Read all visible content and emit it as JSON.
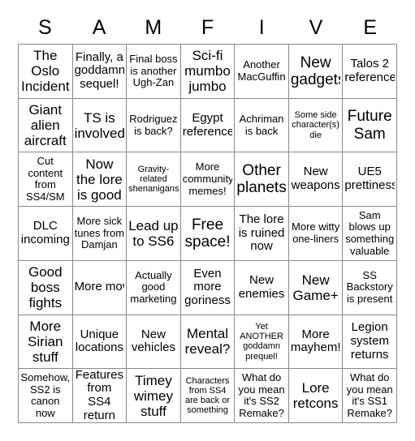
{
  "card": {
    "title_letters": [
      "S",
      "A",
      "M",
      "F",
      "I",
      "V",
      "E"
    ],
    "rows": 7,
    "columns": 7,
    "colors": {
      "background": "#ffffff",
      "text": "#000000",
      "grid_line": "#888888"
    }
  },
  "cells": [
    [
      {
        "text": "The Oslo Incident",
        "size": "lg"
      },
      {
        "text": "Finally, a goddamn sequel!",
        "size": "md"
      },
      {
        "text": "Final boss is another Ugh-Zan",
        "size": "sm"
      },
      {
        "text": "Sci-fi mumbo jumbo",
        "size": "lg"
      },
      {
        "text": "Another MacGuffin",
        "size": "sm"
      },
      {
        "text": "New gadgets",
        "size": "xl"
      },
      {
        "text": "Talos 2 reference",
        "size": "md"
      }
    ],
    [
      {
        "text": "Giant alien aircraft",
        "size": "lg"
      },
      {
        "text": "TS is involved",
        "size": "lg"
      },
      {
        "text": "Rodriguez is back?",
        "size": "sm"
      },
      {
        "text": "Egypt reference",
        "size": "md"
      },
      {
        "text": "Achriman is back",
        "size": "sm"
      },
      {
        "text": "Some side character(s) die",
        "size": "xs"
      },
      {
        "text": "Future Sam",
        "size": "xl"
      }
    ],
    [
      {
        "text": "Cut content from SS4/SM",
        "size": "sm"
      },
      {
        "text": "Now the lore is good",
        "size": "lg"
      },
      {
        "text": "Gravity-related shenanigans",
        "size": "xs"
      },
      {
        "text": "More community memes!",
        "size": "sm"
      },
      {
        "text": "Other planets",
        "size": "xl"
      },
      {
        "text": "New weapons",
        "size": "md"
      },
      {
        "text": "UE5 prettiness",
        "size": "md"
      }
    ],
    [
      {
        "text": "DLC incoming",
        "size": "md"
      },
      {
        "text": "More sick tunes from Damjan",
        "size": "sm"
      },
      {
        "text": "Lead up to SS6",
        "size": "lg"
      },
      {
        "text": "Free space!",
        "size": "xl"
      },
      {
        "text": "The lore is ruined now",
        "size": "md"
      },
      {
        "text": "More witty one-liners",
        "size": "sm"
      },
      {
        "text": "Sam blows up something valuable",
        "size": "sm"
      }
    ],
    [
      {
        "text": "Good boss fights",
        "size": "lg"
      },
      {
        "text": "More moveme",
        "size": "md",
        "clip": true
      },
      {
        "text": "Actually good marketing",
        "size": "sm"
      },
      {
        "text": "Even more goriness",
        "size": "md"
      },
      {
        "text": "New enemies",
        "size": "md"
      },
      {
        "text": "New Game+",
        "size": "lg"
      },
      {
        "text": "SS Backstory is present",
        "size": "sm"
      }
    ],
    [
      {
        "text": "More Sirian stuff",
        "size": "lg"
      },
      {
        "text": "Unique locations",
        "size": "md"
      },
      {
        "text": "New vehicles",
        "size": "md"
      },
      {
        "text": "Mental reveal?",
        "size": "lg"
      },
      {
        "text": "Yet ANOTHER goddamn prequel!",
        "size": "xs"
      },
      {
        "text": "More mayhem!",
        "size": "md"
      },
      {
        "text": "Legion system returns",
        "size": "md"
      }
    ],
    [
      {
        "text": "Somehow, SS2 is canon now",
        "size": "sm"
      },
      {
        "text": "Features from SS4 return",
        "size": "md"
      },
      {
        "text": "Timey wimey stuff",
        "size": "lg"
      },
      {
        "text": "Characters from SS4 are back or something",
        "size": "xs"
      },
      {
        "text": "What do you mean it's SS2 Remake?",
        "size": "sm"
      },
      {
        "text": "Lore retcons",
        "size": "lg"
      },
      {
        "text": "What do you mean it's SS1 Remake?",
        "size": "sm"
      }
    ]
  ]
}
